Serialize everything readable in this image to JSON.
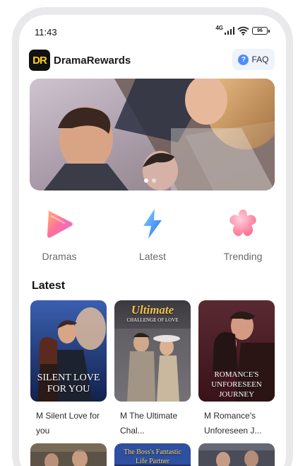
{
  "status_bar": {
    "time": "11:43",
    "network": "4G",
    "battery": "96"
  },
  "header": {
    "app_title": "DramaRewards",
    "logo_text": "DR",
    "faq_label": "FAQ"
  },
  "banner": {
    "slide_count": 2,
    "active_slide": 1
  },
  "categories": [
    {
      "label": "Dramas",
      "icon": "play-triangle-icon"
    },
    {
      "label": "Latest",
      "icon": "lightning-bolt-icon"
    },
    {
      "label": "Trending",
      "icon": "flower-star-icon"
    }
  ],
  "latest": {
    "title": "Latest",
    "items": [
      {
        "title": "M Silent Love for you",
        "cover_text": "SILENT LOVE FOR YOU"
      },
      {
        "title": "M The Ultimate Chal...",
        "cover_text": "Ultimate",
        "cover_subtext": "CHALLENGE OF LOVE"
      },
      {
        "title": "M  Romance's Unforeseen J...",
        "cover_text": "ROMANCE'S UNFORESEEN JOURNEY"
      }
    ],
    "second_row": [
      {
        "cover_text": ""
      },
      {
        "cover_text": "The Boss's Fantastic Life Partner"
      },
      {
        "cover_text": ""
      }
    ]
  },
  "colors": {
    "accent": "#4f8cf7",
    "logo_yellow": "#ffd21e",
    "faq_bg": "#eef3fc"
  }
}
